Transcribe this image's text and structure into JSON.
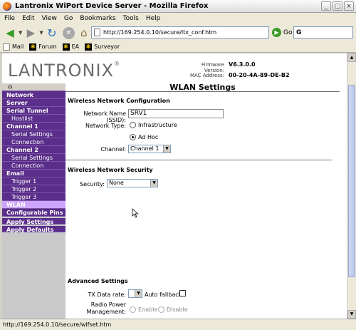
{
  "window": {
    "title": "Lantronix WiPort Device Server - Mozilla Firefox"
  },
  "menu": [
    "File",
    "Edit",
    "View",
    "Go",
    "Bookmarks",
    "Tools",
    "Help"
  ],
  "address": {
    "url": "http://169.254.0.10/secure/ltx_conf.htm",
    "go_label": "Go",
    "search_value": "G"
  },
  "bookmarks": [
    "Mail",
    "Forum",
    "EA",
    "Surveyor"
  ],
  "header": {
    "logo": "LANTRONIX",
    "firmware_label": "Firmware Version:",
    "firmware_value": "V6.3.0.0",
    "mac_label": "MAC Address:",
    "mac_value": "00-20-4A-89-DE-B2"
  },
  "sidebar": {
    "items": [
      "Network",
      "Server",
      "Serial Tunnel",
      "Hostlist",
      "Channel 1",
      "Serial Settings",
      "Connection",
      "Channel 2",
      "Serial Settings",
      "Connection",
      "Email",
      "Trigger 1",
      "Trigger 2",
      "Trigger 3",
      "WLAN",
      "Configurable Pins",
      "Apply Settings",
      "Apply Defaults"
    ]
  },
  "page": {
    "title": "WLAN Settings",
    "wireless_config_heading": "Wireless Network Configuration",
    "ssid_label": "Network Name (SSID):",
    "ssid_value": "SRV1",
    "network_type_label": "Network Type:",
    "opt_infrastructure": "Infrastructure",
    "opt_adhoc": "Ad Hoc",
    "channel_label": "Channel:",
    "channel_value": "Channel 1",
    "security_heading": "Wireless Network Security",
    "security_label": "Security:",
    "security_value": "None",
    "advanced_heading": "Advanced Settings",
    "tx_rate_label": "TX Data rate:",
    "auto_fallback_label": "Auto fallback",
    "radio_power_label_1": "Radio Power",
    "radio_power_label_2": "Management:",
    "opt_enable": "Enable",
    "opt_disable": "Disable"
  },
  "status": {
    "text": "http://169.254.0.10/secure/wlfset.htm"
  }
}
